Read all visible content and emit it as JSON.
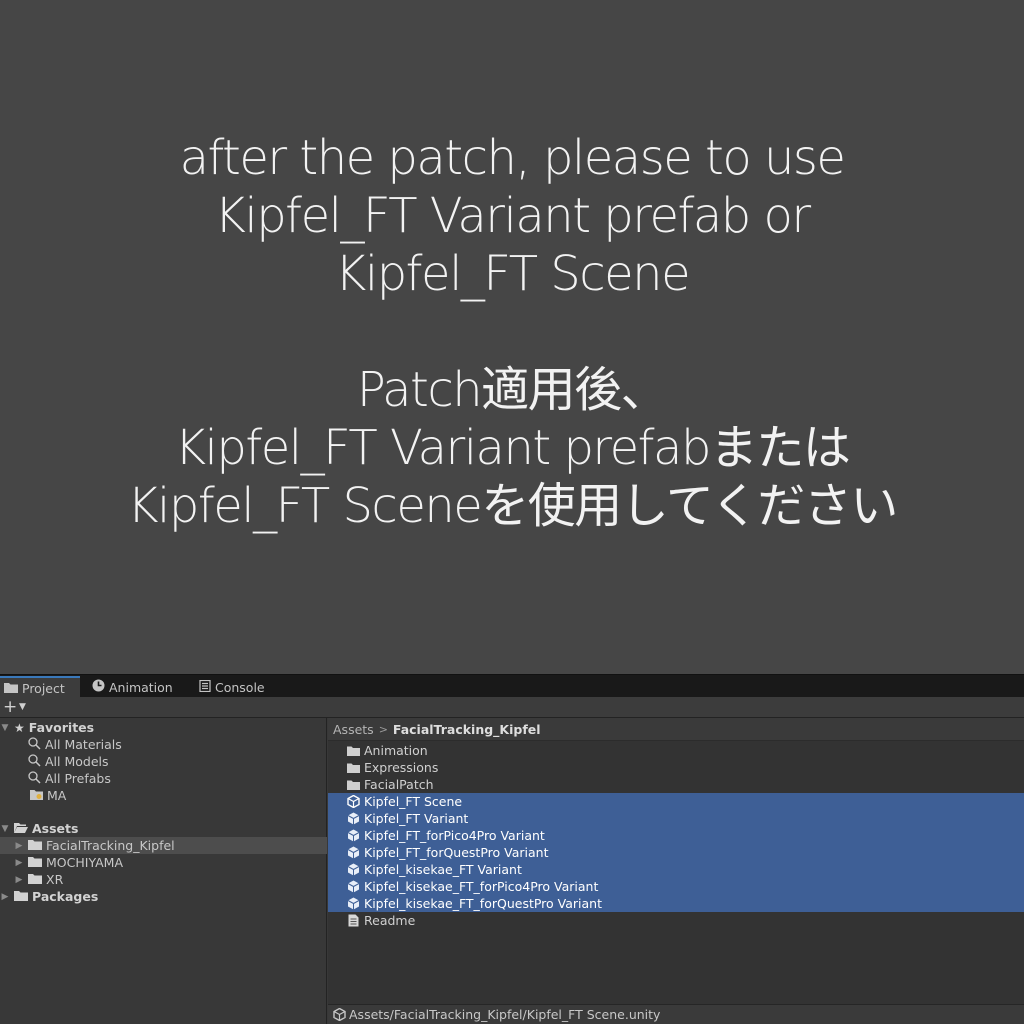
{
  "notice": {
    "en_lines": [
      "after the patch, please to use",
      "Kipfel_FT Variant prefab or",
      "Kipfel_FT Scene"
    ],
    "ja_lines": [
      "Patch適用後、",
      "Kipfel_FT Variant prefabまたは",
      "Kipfel_FT Sceneを使用してください"
    ]
  },
  "tabs": [
    {
      "label": "Project",
      "icon": "folder-icon",
      "active": true
    },
    {
      "label": "Animation",
      "icon": "clock-icon",
      "active": false
    },
    {
      "label": "Console",
      "icon": "console-icon",
      "active": false
    }
  ],
  "toolbar": {
    "add_icon": "plus-icon",
    "dropdown_icon": "caret-down-icon"
  },
  "tree": {
    "favorites_label": "Favorites",
    "favorites": [
      "All Materials",
      "All Models",
      "All Prefabs",
      "MA"
    ],
    "assets_label": "Assets",
    "assets": [
      "FacialTracking_Kipfel",
      "MOCHIYAMA",
      "XR"
    ],
    "packages_label": "Packages"
  },
  "breadcrumb": {
    "root": "Assets",
    "current": "FacialTracking_Kipfel"
  },
  "files": [
    {
      "name": "Animation",
      "icon": "folder-icon",
      "selected": false
    },
    {
      "name": "Expressions",
      "icon": "folder-icon",
      "selected": false
    },
    {
      "name": "FacialPatch",
      "icon": "folder-icon",
      "selected": false
    },
    {
      "name": "Kipfel_FT Scene",
      "icon": "unity-scene-icon",
      "selected": true
    },
    {
      "name": "Kipfel_FT Variant",
      "icon": "prefab-variant-icon",
      "selected": true
    },
    {
      "name": "Kipfel_FT_forPico4Pro Variant",
      "icon": "prefab-variant-icon",
      "selected": true
    },
    {
      "name": "Kipfel_FT_forQuestPro Variant",
      "icon": "prefab-variant-icon",
      "selected": true
    },
    {
      "name": "Kipfel_kisekae_FT Variant",
      "icon": "prefab-variant-icon",
      "selected": true
    },
    {
      "name": "Kipfel_kisekae_FT_forPico4Pro Variant",
      "icon": "prefab-variant-icon",
      "selected": true
    },
    {
      "name": "Kipfel_kisekae_FT_forQuestPro Variant",
      "icon": "prefab-variant-icon",
      "selected": true
    },
    {
      "name": "Readme",
      "icon": "document-icon",
      "selected": false
    }
  ],
  "status": {
    "path": "Assets/FacialTracking_Kipfel/Kipfel_FT Scene.unity"
  },
  "colors": {
    "background": "#464646",
    "selection": "#3e5f96",
    "accent": "#3a79bb"
  }
}
